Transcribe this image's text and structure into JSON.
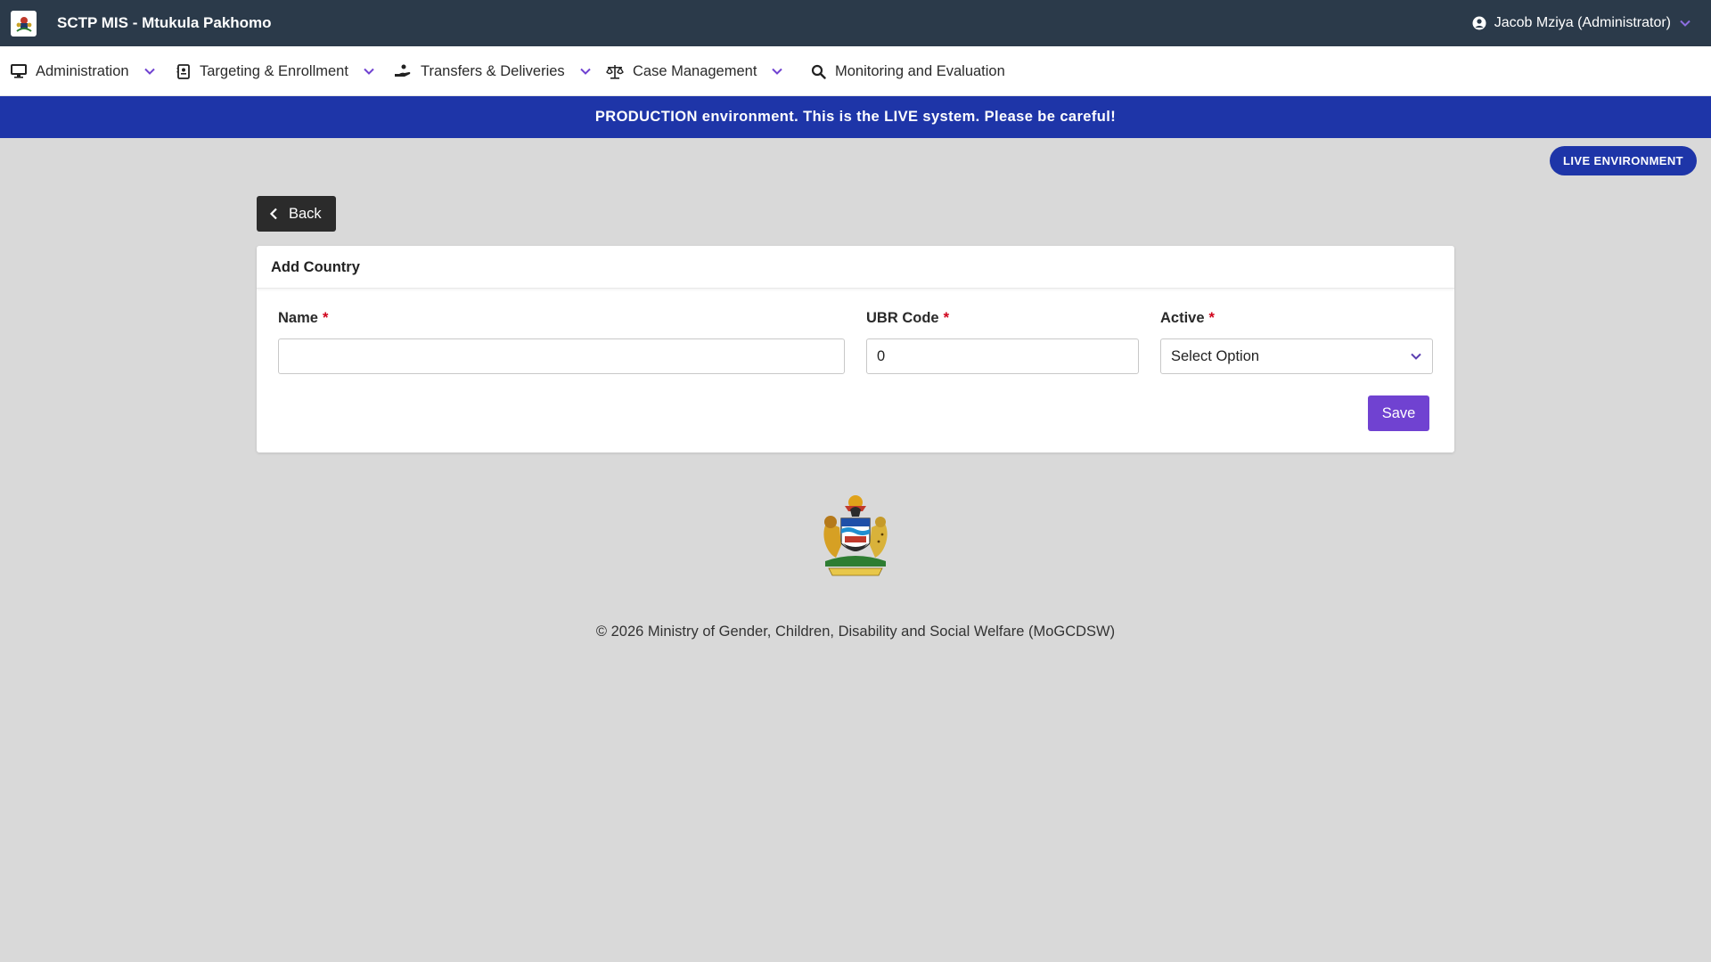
{
  "app": {
    "title": "SCTP MIS - Mtukula Pakhomo",
    "user": "Jacob Mziya (Administrator)"
  },
  "nav": {
    "items": [
      {
        "label": "Administration",
        "icon": "monitor-icon",
        "dropdown": true
      },
      {
        "label": "Targeting & Enrollment",
        "icon": "id-card-icon",
        "dropdown": true
      },
      {
        "label": "Transfers & Deliveries",
        "icon": "hand-coins-icon",
        "dropdown": true
      },
      {
        "label": "Case Management",
        "icon": "scales-icon",
        "dropdown": true
      },
      {
        "label": "Monitoring and Evaluation",
        "icon": "search-icon",
        "dropdown": false
      }
    ]
  },
  "banner": {
    "text": "PRODUCTION environment. This is the LIVE system. Please be careful!"
  },
  "badge": {
    "text": "LIVE ENVIRONMENT"
  },
  "back": {
    "label": "Back"
  },
  "form": {
    "title": "Add Country",
    "name": {
      "label": "Name",
      "required_mark": "*",
      "value": ""
    },
    "ubr_code": {
      "label": "UBR Code",
      "required_mark": "*",
      "value": "0"
    },
    "active": {
      "label": "Active",
      "required_mark": "*",
      "selected": "Select Option"
    },
    "save_label": "Save"
  },
  "footer": {
    "copyright": "© 2026 Ministry of Gender, Children, Disability and Social Welfare (MoGCDSW)"
  },
  "colors": {
    "topbar": "#2b3a4a",
    "banner": "#1e35a8",
    "accent": "#7042d1",
    "required": "#d0021b",
    "background": "#d9d9d9"
  }
}
